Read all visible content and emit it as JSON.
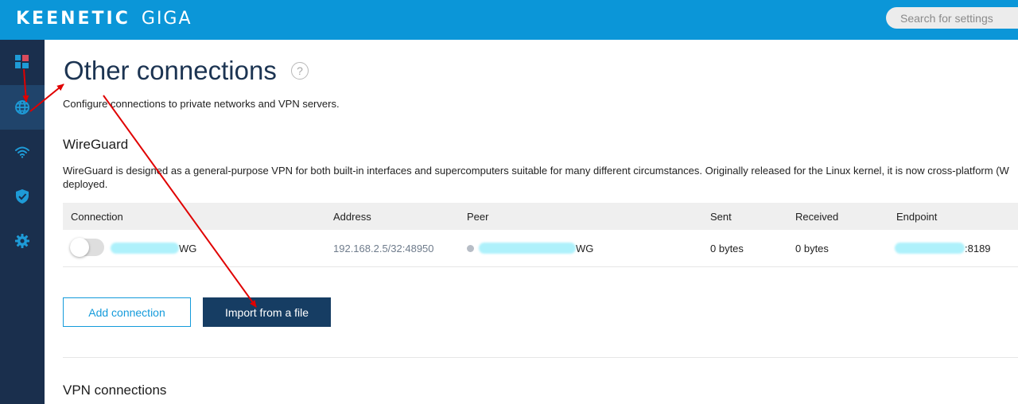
{
  "header": {
    "brand": "KEENETIC",
    "model": "GIGA",
    "search_placeholder": "Search for settings"
  },
  "sidebar": {
    "items": [
      {
        "icon": "dashboard-icon"
      },
      {
        "icon": "globe-icon",
        "active": true
      },
      {
        "icon": "wifi-icon"
      },
      {
        "icon": "shield-icon"
      },
      {
        "icon": "gear-icon"
      }
    ]
  },
  "page": {
    "title": "Other connections",
    "help_glyph": "?",
    "description": "Configure connections to private networks and VPN servers."
  },
  "wireguard": {
    "title": "WireGuard",
    "description": "WireGuard is designed as a general-purpose VPN for both built-in interfaces and supercomputers suitable for many different circumstances. Originally released for the Linux kernel, it is now cross-platform (W deployed.",
    "columns": [
      "Connection",
      "Address",
      "Peer",
      "Sent",
      "Received",
      "Endpoint"
    ],
    "rows": [
      {
        "enabled": false,
        "connection_suffix": "WG",
        "address": "192.168.2.5/32:48950",
        "peer_suffix": "WG",
        "sent": "0 bytes",
        "received": "0 bytes",
        "endpoint_suffix": ":8189"
      }
    ],
    "add_button": "Add connection",
    "import_button": "Import from a file"
  },
  "vpn": {
    "title": "VPN connections"
  },
  "colors": {
    "topbar": "#0b96d8",
    "sidebar": "#1a2f4d",
    "sidebar_active": "#20446b",
    "icon": "#1e9bd7",
    "primary_button": "#163d63",
    "annotation": "#e00000"
  }
}
